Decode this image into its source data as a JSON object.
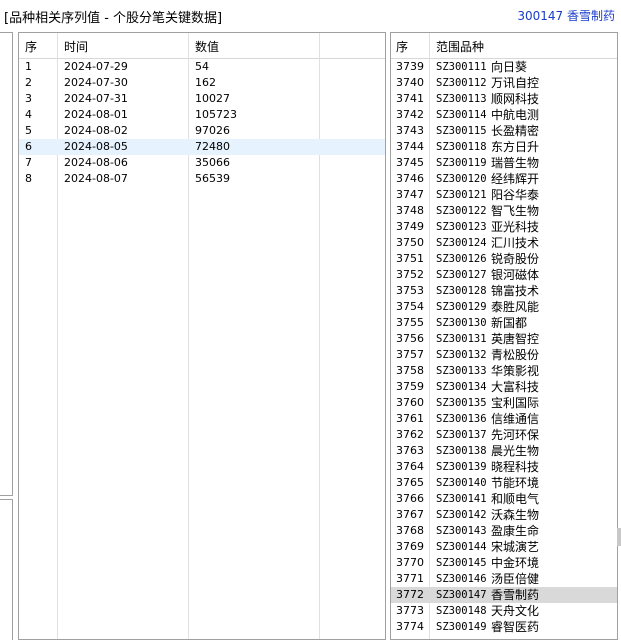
{
  "title": "[品种相关序列值 - 个股分笔关键数据]",
  "stock_label": "300147 香雪制药",
  "series_table": {
    "headers": {
      "idx": "序",
      "time": "时间",
      "value": "数值"
    },
    "selected_index": 5,
    "rows": [
      {
        "idx": "1",
        "time": "2024-07-29",
        "value": "54"
      },
      {
        "idx": "2",
        "time": "2024-07-30",
        "value": "162"
      },
      {
        "idx": "3",
        "time": "2024-07-31",
        "value": "10027"
      },
      {
        "idx": "4",
        "time": "2024-08-01",
        "value": "105723"
      },
      {
        "idx": "5",
        "time": "2024-08-02",
        "value": "97026"
      },
      {
        "idx": "6",
        "time": "2024-08-05",
        "value": "72480"
      },
      {
        "idx": "7",
        "time": "2024-08-06",
        "value": "35066"
      },
      {
        "idx": "8",
        "time": "2024-08-07",
        "value": "56539"
      }
    ]
  },
  "symbol_table": {
    "headers": {
      "idx": "序",
      "symbol": "范围品种"
    },
    "selected_index": 33,
    "rows": [
      {
        "idx": "3739",
        "code": "SZ300111",
        "name": "向日葵"
      },
      {
        "idx": "3740",
        "code": "SZ300112",
        "name": "万讯自控"
      },
      {
        "idx": "3741",
        "code": "SZ300113",
        "name": "顺网科技"
      },
      {
        "idx": "3742",
        "code": "SZ300114",
        "name": "中航电测"
      },
      {
        "idx": "3743",
        "code": "SZ300115",
        "name": "长盈精密"
      },
      {
        "idx": "3744",
        "code": "SZ300118",
        "name": "东方日升"
      },
      {
        "idx": "3745",
        "code": "SZ300119",
        "name": "瑞普生物"
      },
      {
        "idx": "3746",
        "code": "SZ300120",
        "name": "经纬辉开"
      },
      {
        "idx": "3747",
        "code": "SZ300121",
        "name": "阳谷华泰"
      },
      {
        "idx": "3748",
        "code": "SZ300122",
        "name": "智飞生物"
      },
      {
        "idx": "3749",
        "code": "SZ300123",
        "name": "亚光科技"
      },
      {
        "idx": "3750",
        "code": "SZ300124",
        "name": "汇川技术"
      },
      {
        "idx": "3751",
        "code": "SZ300126",
        "name": "锐奇股份"
      },
      {
        "idx": "3752",
        "code": "SZ300127",
        "name": "银河磁体"
      },
      {
        "idx": "3753",
        "code": "SZ300128",
        "name": "锦富技术"
      },
      {
        "idx": "3754",
        "code": "SZ300129",
        "name": "泰胜风能"
      },
      {
        "idx": "3755",
        "code": "SZ300130",
        "name": "新国都"
      },
      {
        "idx": "3756",
        "code": "SZ300131",
        "name": "英唐智控"
      },
      {
        "idx": "3757",
        "code": "SZ300132",
        "name": "青松股份"
      },
      {
        "idx": "3758",
        "code": "SZ300133",
        "name": "华策影视"
      },
      {
        "idx": "3759",
        "code": "SZ300134",
        "name": "大富科技"
      },
      {
        "idx": "3760",
        "code": "SZ300135",
        "name": "宝利国际"
      },
      {
        "idx": "3761",
        "code": "SZ300136",
        "name": "信维通信"
      },
      {
        "idx": "3762",
        "code": "SZ300137",
        "name": "先河环保"
      },
      {
        "idx": "3763",
        "code": "SZ300138",
        "name": "晨光生物"
      },
      {
        "idx": "3764",
        "code": "SZ300139",
        "name": "晓程科技"
      },
      {
        "idx": "3765",
        "code": "SZ300140",
        "name": "节能环境"
      },
      {
        "idx": "3766",
        "code": "SZ300141",
        "name": "和顺电气"
      },
      {
        "idx": "3767",
        "code": "SZ300142",
        "name": "沃森生物"
      },
      {
        "idx": "3768",
        "code": "SZ300143",
        "name": "盈康生命"
      },
      {
        "idx": "3769",
        "code": "SZ300144",
        "name": "宋城演艺"
      },
      {
        "idx": "3770",
        "code": "SZ300145",
        "name": "中金环境"
      },
      {
        "idx": "3771",
        "code": "SZ300146",
        "name": "汤臣倍健"
      },
      {
        "idx": "3772",
        "code": "SZ300147",
        "name": "香雪制药"
      },
      {
        "idx": "3773",
        "code": "SZ300148",
        "name": "天舟文化"
      },
      {
        "idx": "3774",
        "code": "SZ300149",
        "name": "睿智医药"
      }
    ]
  },
  "colors": {
    "title_stock": "#1a3cc8",
    "selected_row": "#e6f2fd",
    "selected_row_gray": "#d9d9d9",
    "border": "#a0a0a0"
  }
}
